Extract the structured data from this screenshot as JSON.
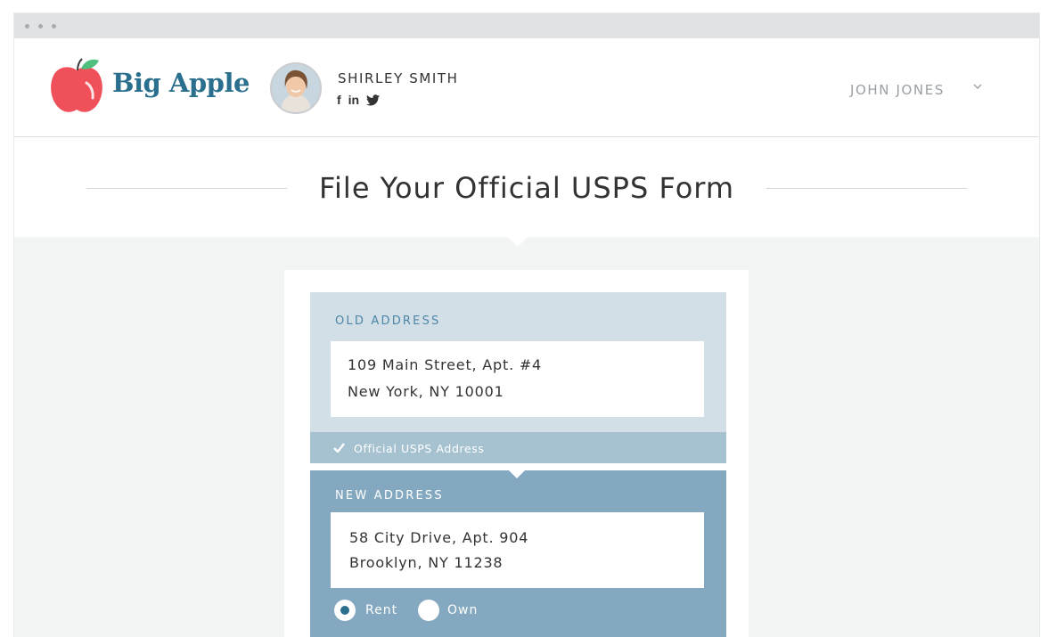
{
  "brand": {
    "name": "Big Apple"
  },
  "profile": {
    "name": "SHIRLEY SMITH",
    "socials": [
      "facebook-icon",
      "linkedin-icon",
      "twitter-icon"
    ]
  },
  "account": {
    "name": "JOHN JONES"
  },
  "page": {
    "title": "File Your Official USPS Form"
  },
  "old_address": {
    "label": "OLD ADDRESS",
    "line1": "109 Main Street, Apt. #4",
    "line2": "New York, NY 10001",
    "verified_text": "Official USPS Address"
  },
  "new_address": {
    "label": "NEW ADDRESS",
    "line1": "58 City Drive, Apt. 904",
    "line2": "Brooklyn, NY 11238",
    "options": [
      {
        "label": "Rent",
        "selected": true
      },
      {
        "label": "Own",
        "selected": false
      }
    ]
  },
  "colors": {
    "brand": "#2a6f8e",
    "apple": "#f0505a",
    "old_panel": "#d2dfe7",
    "verified_bar": "#a6c2d0",
    "new_panel": "#83a8bf"
  }
}
